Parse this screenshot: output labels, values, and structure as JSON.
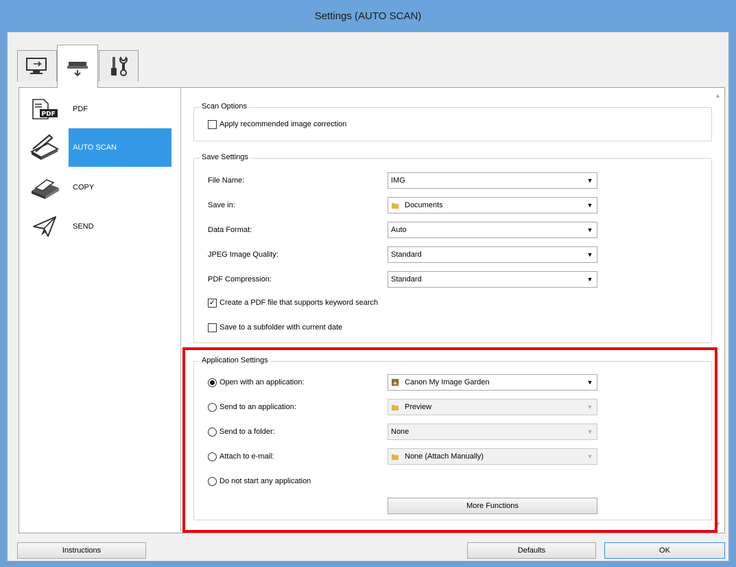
{
  "window": {
    "title": "Settings (AUTO SCAN)"
  },
  "tabs": [
    {
      "icon": "computer-scan-icon"
    },
    {
      "icon": "scanner-icon"
    },
    {
      "icon": "tools-icon"
    }
  ],
  "sidebar": {
    "items": [
      {
        "label": "PDF",
        "icon": "pdf-icon"
      },
      {
        "label": "AUTO SCAN",
        "icon": "scanner-icon"
      },
      {
        "label": "COPY",
        "icon": "printer-copy-icon"
      },
      {
        "label": "SEND",
        "icon": "paper-plane-icon"
      }
    ],
    "selected": "AUTO SCAN"
  },
  "scan_options": {
    "title": "Scan Options",
    "apply_correction": {
      "label": "Apply recommended image correction",
      "checked": false
    }
  },
  "save_settings": {
    "title": "Save Settings",
    "file_name": {
      "label": "File Name:",
      "value": "IMG"
    },
    "save_in": {
      "label": "Save in:",
      "value": "Documents"
    },
    "data_format": {
      "label": "Data Format:",
      "value": "Auto"
    },
    "jpeg_quality": {
      "label": "JPEG Image Quality:",
      "value": "Standard"
    },
    "pdf_compression": {
      "label": "PDF Compression:",
      "value": "Standard"
    },
    "keyword_pdf": {
      "label": "Create a PDF file that supports keyword search",
      "checked": true
    },
    "subfolder": {
      "label": "Save to a subfolder with current date",
      "checked": false
    }
  },
  "application_settings": {
    "title": "Application Settings",
    "open_with": {
      "label": "Open with an application:",
      "value": "Canon My Image Garden",
      "selected": true
    },
    "send_to_app": {
      "label": "Send to an application:",
      "value": "Preview"
    },
    "send_to_folder": {
      "label": "Send to a folder:",
      "value": "None"
    },
    "attach_email": {
      "label": "Attach to e-mail:",
      "value": "None (Attach Manually)"
    },
    "no_app": {
      "label": "Do not start any application"
    },
    "more_functions": "More Functions"
  },
  "footer": {
    "instructions": "Instructions",
    "defaults": "Defaults",
    "ok": "OK"
  },
  "colors": {
    "title_bar": "#6ba4dc",
    "selection": "#3399e6",
    "highlight_box": "#e8000e"
  }
}
